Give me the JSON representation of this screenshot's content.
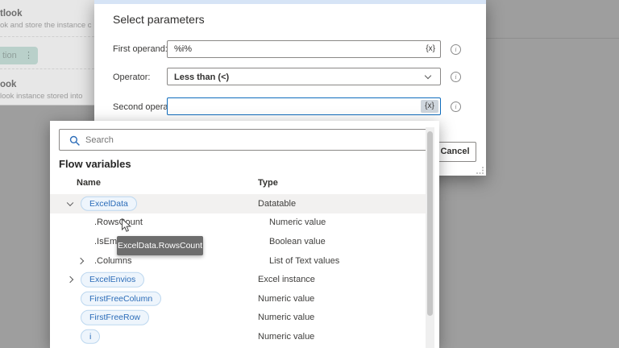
{
  "colors": {
    "overlay": "#9e9e9e",
    "accent_focus": "#0f6cbd",
    "dialog_accent_bar": "#d6e4f6",
    "pill_text": "#2b6cb8",
    "pill_bg": "#eef5fc",
    "selected_action_bg": "#b9d0ca",
    "tooltip_bg": "#6d6d6d",
    "row_highlight": "#f2f1f0"
  },
  "background": {
    "action1": {
      "title": "tlook",
      "subtitle": "ok and store the instance c"
    },
    "selected_action": {
      "label": "tion"
    },
    "action2": {
      "title": "ook",
      "subtitle": "look instance stored into"
    }
  },
  "dialog": {
    "title": "Select parameters",
    "fx_label": "{x}",
    "fields": [
      {
        "label": "First operand:",
        "value": "%i%"
      },
      {
        "label": "Operator:",
        "value": "Less than (<)"
      },
      {
        "label": "Second operand:",
        "value": ""
      }
    ],
    "cancel_label": "Cancel"
  },
  "popup": {
    "search_placeholder": "Search",
    "heading": "Flow variables",
    "columns": [
      "Name",
      "Type"
    ],
    "rows": [
      {
        "name": "ExcelData",
        "type": "Datatable",
        "pill": true,
        "chevron": "down",
        "level": 0,
        "highlighted": true
      },
      {
        "name": ".RowsCount",
        "type": "Numeric value",
        "pill": false,
        "level": 1
      },
      {
        "name": ".IsEmpty",
        "type": "Boolean value",
        "pill": false,
        "level": 1
      },
      {
        "name": ".Columns",
        "type": "List of Text values",
        "pill": false,
        "chevron": "right",
        "level": 1
      },
      {
        "name": "ExcelEnvios",
        "type": "Excel instance",
        "pill": true,
        "chevron": "right",
        "level": 0
      },
      {
        "name": "FirstFreeColumn",
        "type": "Numeric value",
        "pill": true,
        "level": 0
      },
      {
        "name": "FirstFreeRow",
        "type": "Numeric value",
        "pill": true,
        "level": 0
      },
      {
        "name": "i",
        "type": "Numeric value",
        "pill": true,
        "level": 0
      }
    ],
    "tooltip": "ExcelData.RowsCount"
  },
  "icons": {
    "search": "magnifier",
    "info": "circle-i",
    "dropdown": "chevron-down",
    "fx": "fx-braces",
    "menu": "vertical-dots",
    "cursor": "arrow-pointer",
    "resize": "grip-dots"
  }
}
